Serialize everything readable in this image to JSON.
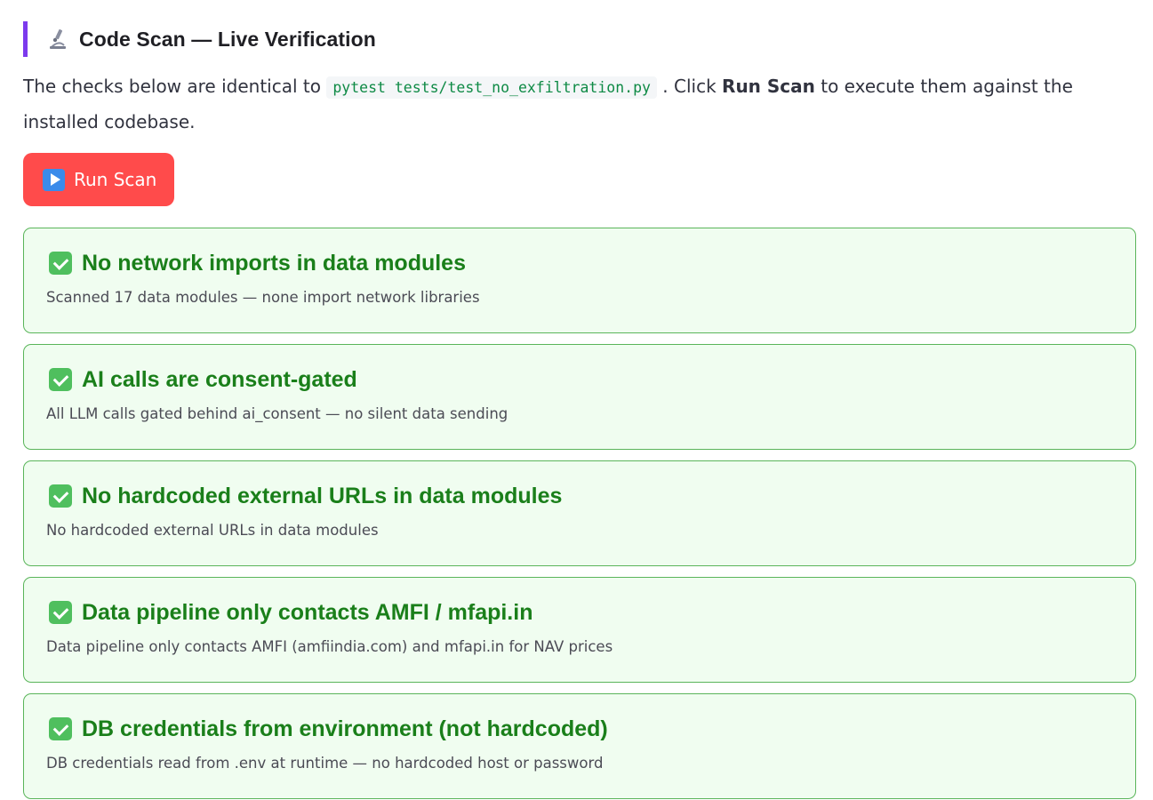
{
  "section": {
    "icon": "microscope-icon",
    "title": "Code Scan — Live Verification"
  },
  "intro": {
    "before_code": "The checks below are identical to ",
    "code": "pytest tests/test_no_exfiltration.py",
    "after_code": " . Click ",
    "bold": "Run Scan",
    "after_bold": " to execute them against the installed codebase."
  },
  "run_button": {
    "icon": "play-icon",
    "label": "Run Scan"
  },
  "checks": [
    {
      "status": "passed",
      "title": "No network imports in data modules",
      "description": "Scanned 17 data modules — none import network libraries"
    },
    {
      "status": "passed",
      "title": "AI calls are consent-gated",
      "description": "All LLM calls gated behind ai_consent — no silent data sending"
    },
    {
      "status": "passed",
      "title": "No hardcoded external URLs in data modules",
      "description": "No hardcoded external URLs in data modules"
    },
    {
      "status": "passed",
      "title": "Data pipeline only contacts AMFI / mfapi.in",
      "description": "Data pipeline only contacts AMFI (amfiindia.com) and mfapi.in for NAV prices"
    },
    {
      "status": "passed",
      "title": "DB credentials from environment (not hardcoded)",
      "description": "DB credentials read from .env at runtime — no hardcoded host or password"
    }
  ],
  "colors": {
    "accent_bar": "#7c3aed",
    "button_bg": "#ff4b4b",
    "card_bg": "#f0fdf0",
    "card_border": "#5ab55a",
    "success_text": "#1a7f1a",
    "code_text": "#0e8a45"
  }
}
